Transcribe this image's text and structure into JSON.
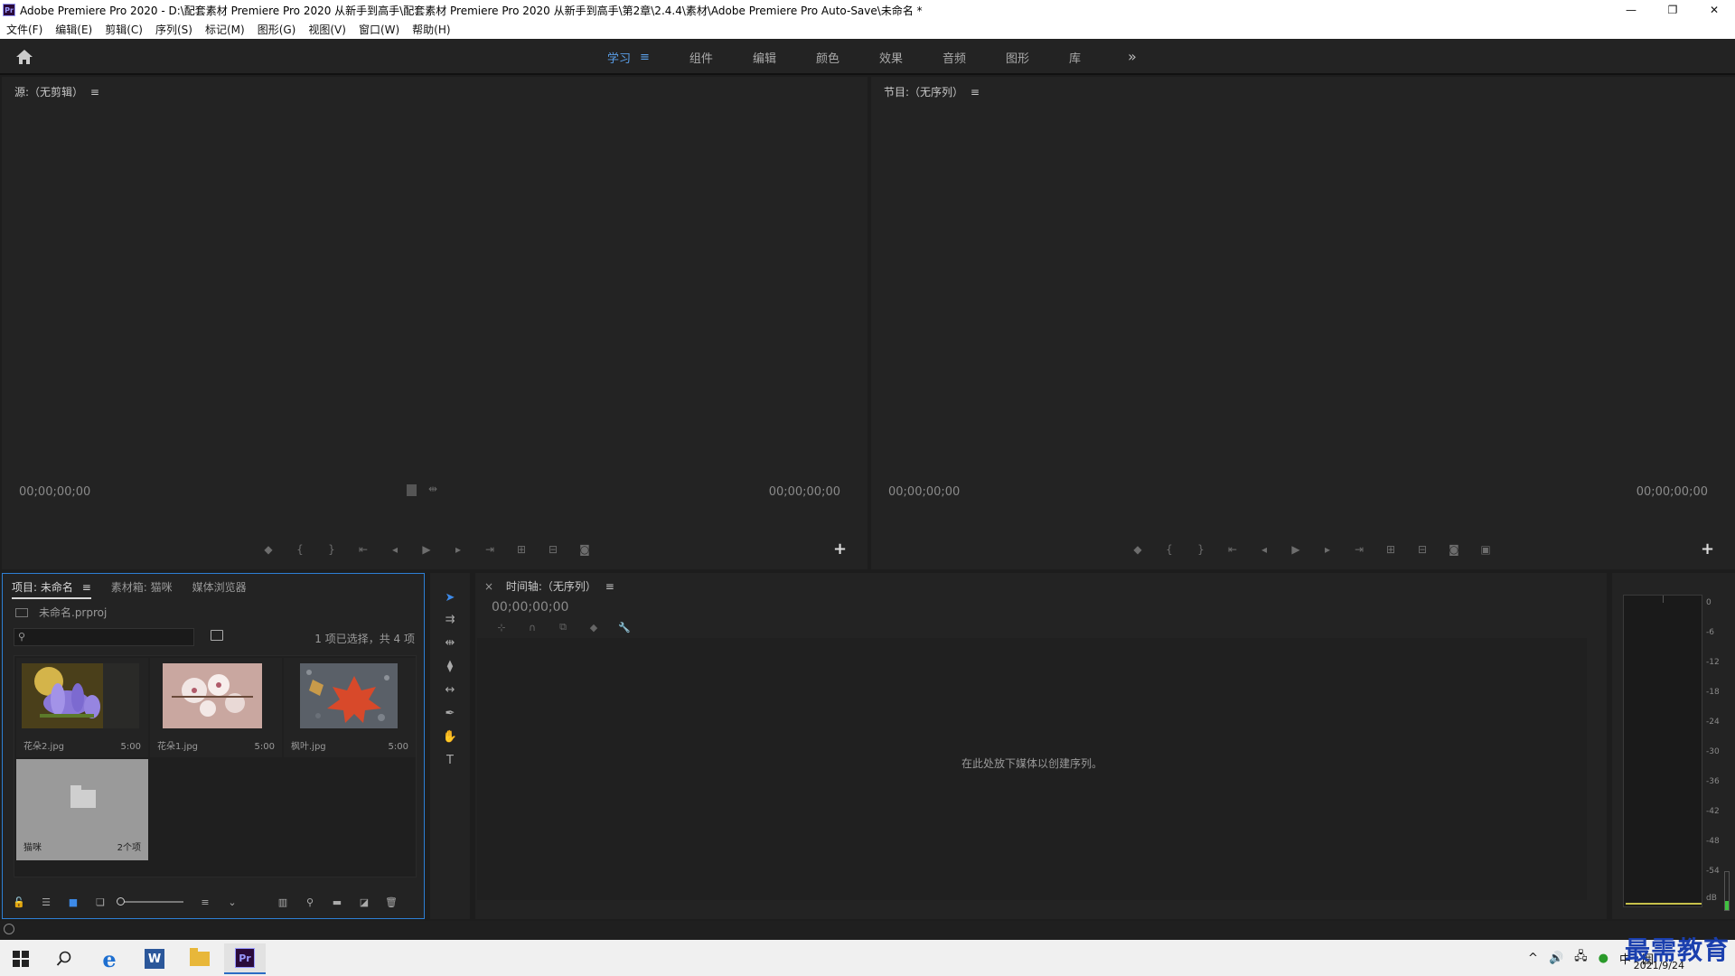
{
  "window": {
    "title": "Adobe Premiere Pro 2020 - D:\\配套素材 Premiere Pro 2020 从新手到高手\\配套素材 Premiere Pro 2020 从新手到高手\\第2章\\2.4.4\\素材\\Adobe Premiere Pro Auto-Save\\未命名 *",
    "app_logo": "Pr",
    "minimize": "—",
    "restore": "❐",
    "close": "✕"
  },
  "menu": [
    "文件(F)",
    "编辑(E)",
    "剪辑(C)",
    "序列(S)",
    "标记(M)",
    "图形(G)",
    "视图(V)",
    "窗口(W)",
    "帮助(H)"
  ],
  "workspaces": {
    "tabs": [
      "学习",
      "组件",
      "编辑",
      "颜色",
      "效果",
      "音频",
      "图形",
      "库"
    ],
    "active_menu_glyph": "≡",
    "more": "»"
  },
  "source": {
    "title": "源:（无剪辑）",
    "menu_glyph": "≡",
    "timecode_left": "00;00;00;00",
    "timecode_right": "00;00;00;00",
    "add": "+"
  },
  "program": {
    "title": "节目:（无序列）",
    "menu_glyph": "≡",
    "timecode_left": "00;00;00;00",
    "timecode_right": "00;00;00;00",
    "add": "+"
  },
  "project": {
    "tabs": [
      "项目: 未命名",
      "素材箱: 猫咪",
      "媒体浏览器"
    ],
    "tab_menu": "≡",
    "file": "未命名.prproj",
    "search_placeholder": "",
    "selection_info": "1 项已选择，共 4 项",
    "items": [
      {
        "name": "花朵2.jpg",
        "duration": "5:00"
      },
      {
        "name": "花朵1.jpg",
        "duration": "5:00"
      },
      {
        "name": "枫叶.jpg",
        "duration": "5:00"
      }
    ],
    "bin": {
      "name": "猫咪",
      "count": "2个项"
    }
  },
  "timeline": {
    "close": "×",
    "title": "时间轴:（无序列）",
    "menu_glyph": "≡",
    "timecode": "00;00;00;00",
    "drop_hint": "在此处放下媒体以创建序列。"
  },
  "meter": {
    "ticks": [
      "0",
      "-6",
      "-12",
      "-18",
      "-24",
      "-30",
      "-36",
      "-42",
      "-48",
      "-54",
      "dB"
    ]
  },
  "taskbar": {
    "date": "2021/9/24",
    "tray": [
      "^",
      "🔊",
      "🖧",
      "中",
      "囲"
    ],
    "watermark": "最需教育",
    "word_label": "W",
    "pr_label": "Pr",
    "ie_label": "e"
  },
  "colors": {
    "accent": "#2d7fd4",
    "workspace_active": "#5a9fe8",
    "panel_bg": "#232323"
  }
}
